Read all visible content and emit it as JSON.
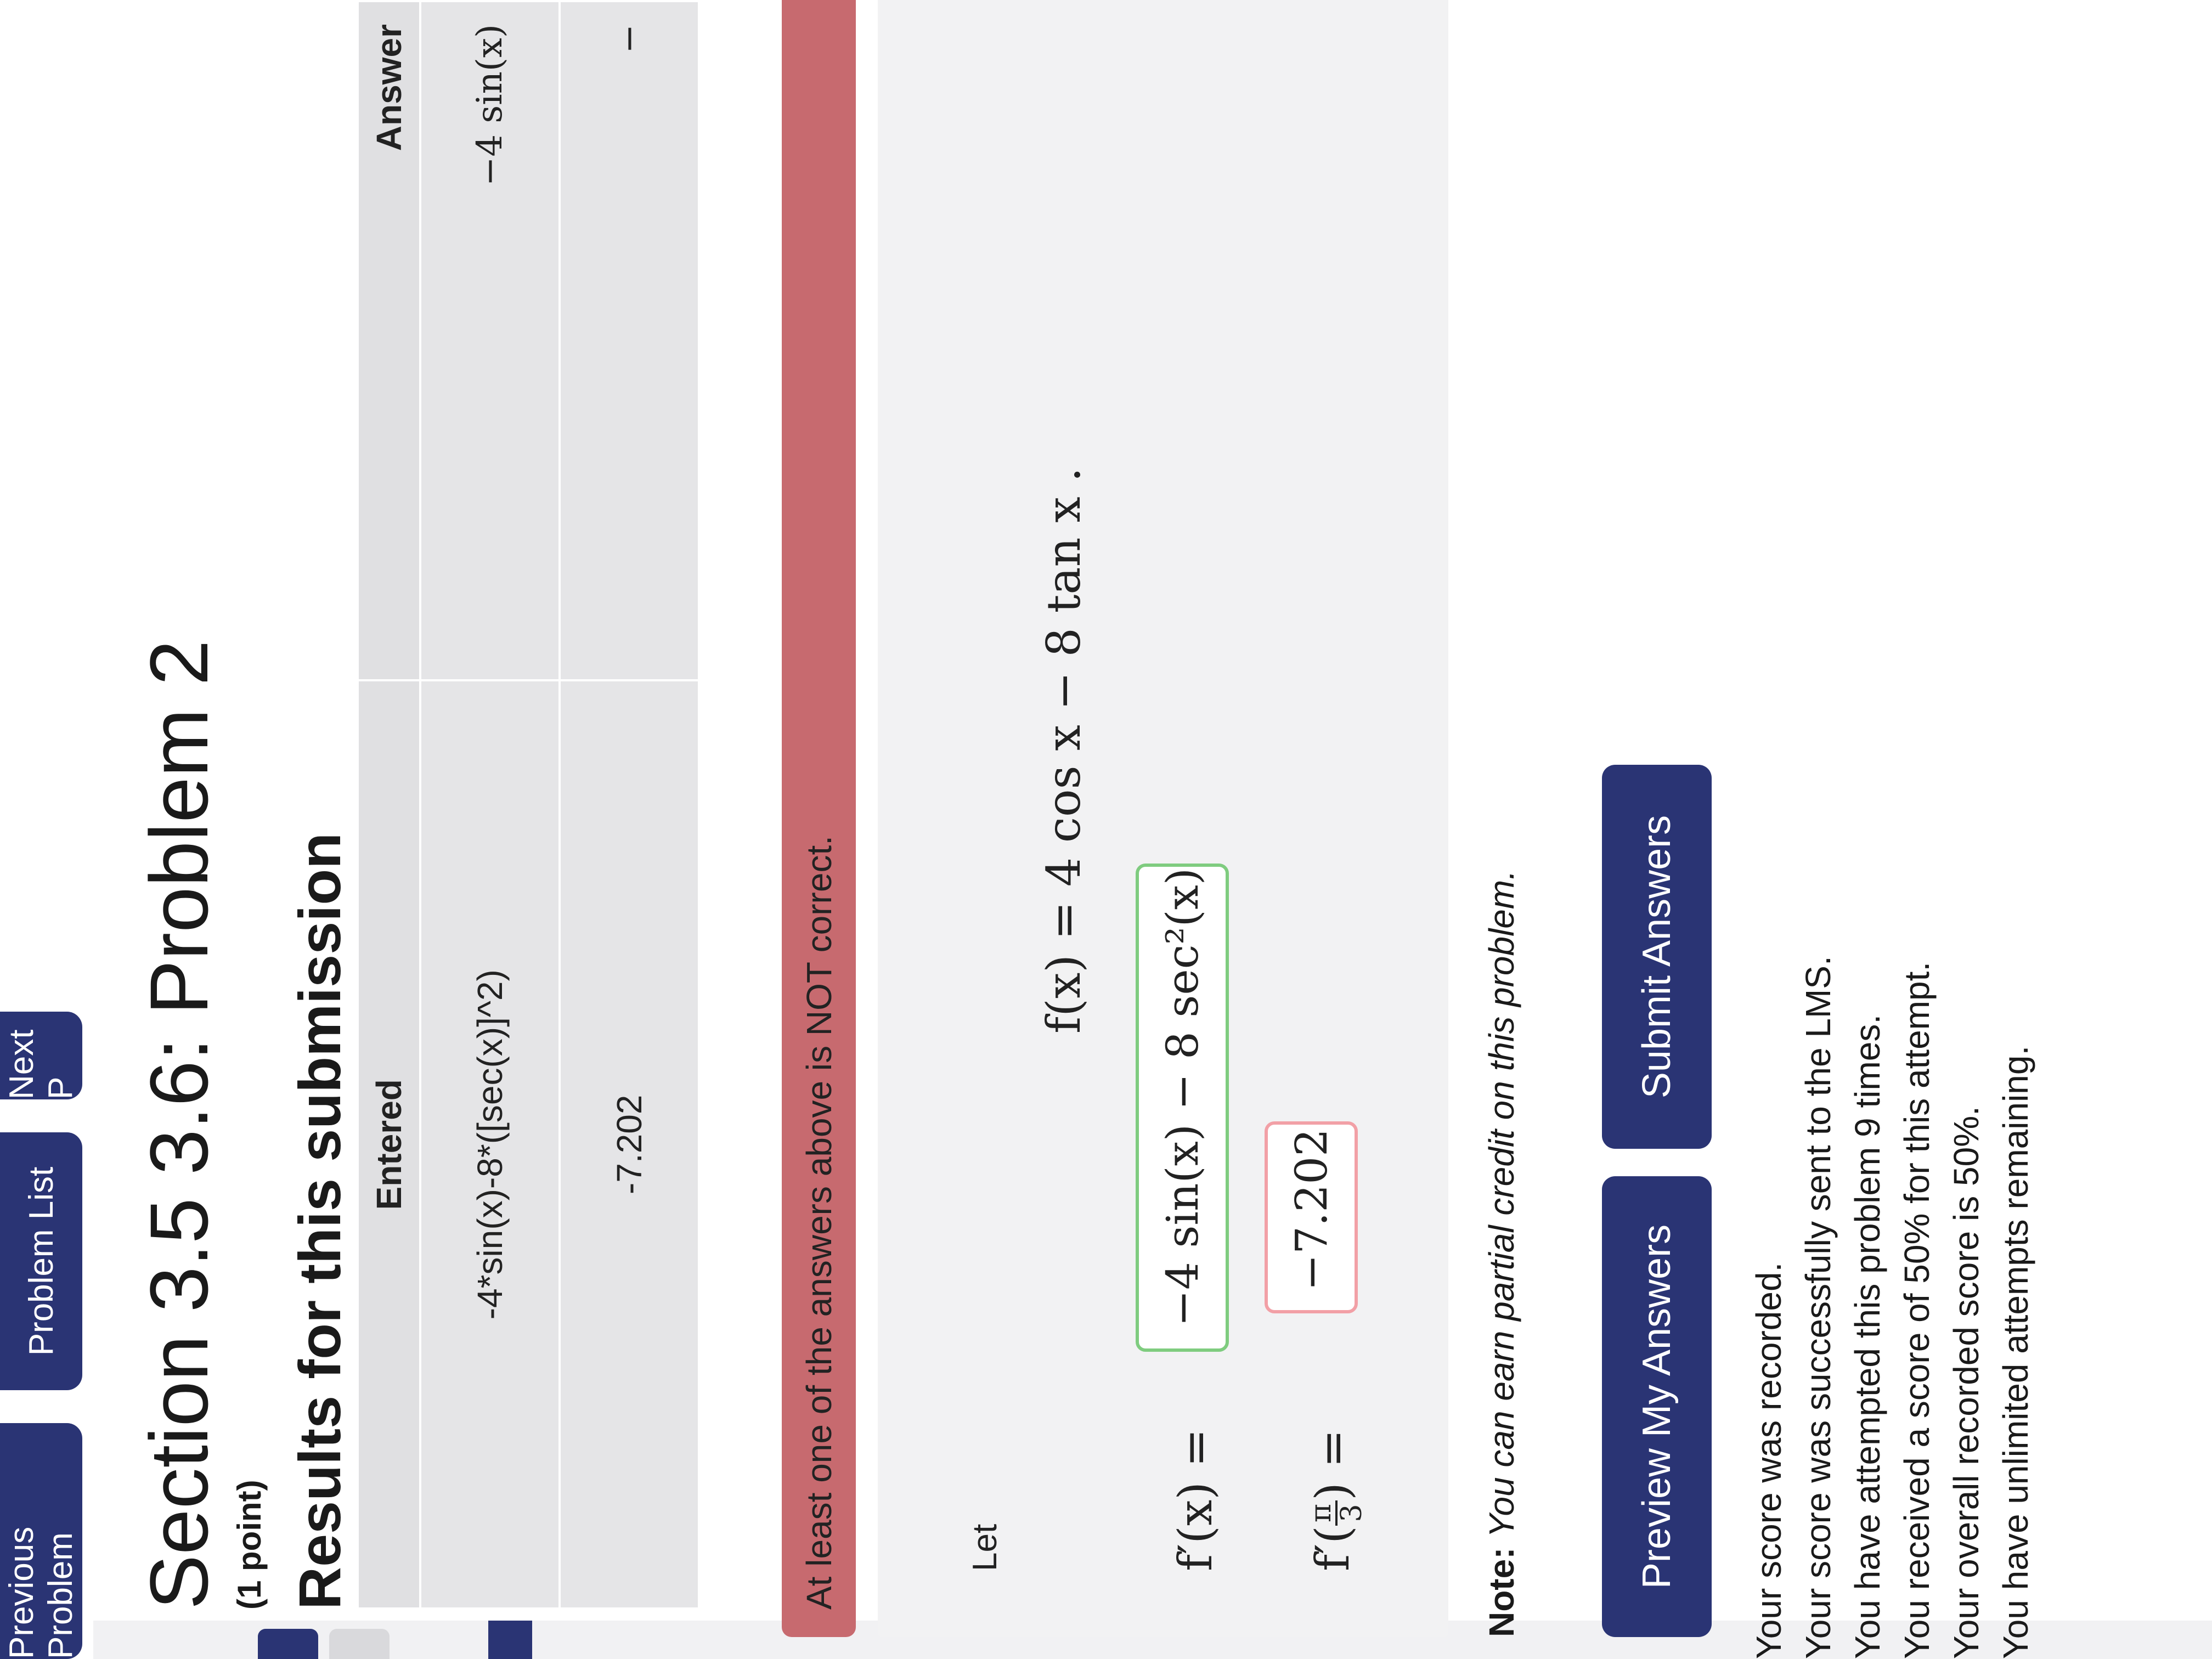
{
  "nav": {
    "previous": "Previous Problem",
    "list": "Problem List",
    "next": "Next P"
  },
  "title": "Section 3.5 3.6: Problem 2",
  "points": "(1 point)",
  "results": {
    "heading": "Results for this submission",
    "headers": {
      "entered": "Entered",
      "answer": "Answer"
    },
    "rows": [
      {
        "entered": "-4*sin(x)-8*([sec(x)]^2)",
        "answer": "−4 sin(x)"
      },
      {
        "entered": "-7.202",
        "answer": "−"
      }
    ]
  },
  "error_banner": "At least one of the answers above is NOT correct.",
  "problem": {
    "let_label": "Let",
    "function_def": "f(x) = 4 cos x − 8 tan x .",
    "fprime_label": "f′(x) =",
    "fprime_value": "−4 sin(x) − 8 sec²(x)",
    "fprime_pi_prefix": "f′(",
    "fprime_pi_num": "π",
    "fprime_pi_den": "3",
    "fprime_pi_suffix": ") =",
    "fprime_pi_value": "−7.202"
  },
  "note": {
    "prefix": "Note:",
    "text": "You can earn partial credit on this problem."
  },
  "buttons": {
    "preview": "Preview My Answers",
    "submit": "Submit Answers"
  },
  "messages": [
    "Your score was recorded.",
    "Your score was successfully sent to the LMS.",
    "You have attempted this problem 9 times.",
    "You received a score of 50% for this attempt.",
    "Your overall recorded score is 50%.",
    "You have unlimited attempts remaining."
  ],
  "colors": {
    "nav_button": "#2a3474",
    "error_banner": "#c76a6f",
    "correct_border": "#7fcc7f",
    "incorrect_border": "#f2a0a6"
  }
}
